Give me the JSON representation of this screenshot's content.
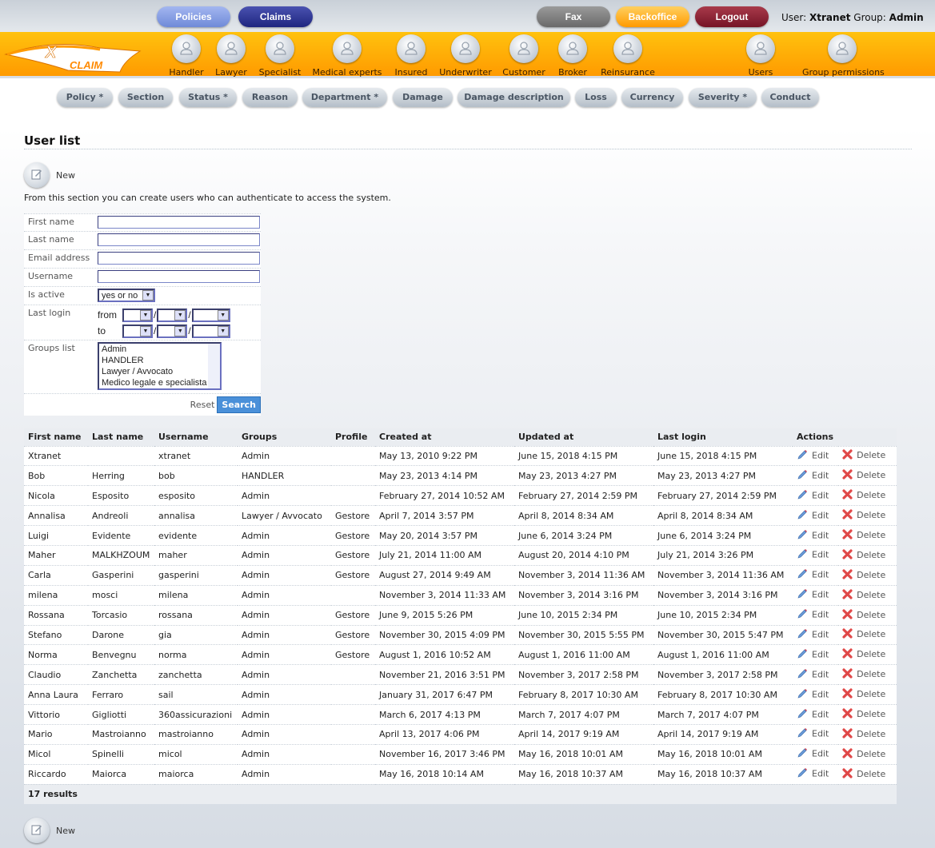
{
  "top_nav": {
    "policies": "Policies",
    "claims": "Claims",
    "fax": "Fax",
    "backoffice": "Backoffice",
    "logout": "Logout"
  },
  "user_info": {
    "user_label": "User:",
    "user": "Xtranet",
    "group_label": "Group:",
    "group": "Admin"
  },
  "logo": {
    "text": "X CLAIM"
  },
  "main_nav": [
    "Handler",
    "Lawyer",
    "Specialist",
    "Medical experts",
    "Insured",
    "Underwriter",
    "Customer",
    "Broker",
    "Reinsurance",
    "Users",
    "Group permissions"
  ],
  "sub_nav": [
    "Policy *",
    "Section",
    "Status *",
    "Reason",
    "Department *",
    "Damage",
    "Damage description",
    "Loss",
    "Currency",
    "Severity *",
    "Conduct"
  ],
  "page": {
    "title": "User list",
    "new_label": "New",
    "intro": "From this section you can create users who can authenticate to access the system."
  },
  "filter": {
    "first_name": "First name",
    "last_name": "Last name",
    "email": "Email address",
    "username": "Username",
    "is_active": "Is active",
    "is_active_value": "yes or no",
    "last_login": "Last login",
    "from": "from",
    "to": "to",
    "sep": "/",
    "groups_list": "Groups list",
    "groups": [
      "Admin",
      "HANDLER",
      "Lawyer / Avvocato",
      "Medico legale e specialista"
    ],
    "reset": "Reset",
    "search": "Search"
  },
  "table": {
    "headers": [
      "First name",
      "Last name",
      "Username",
      "Groups",
      "Profile",
      "Created at",
      "Updated at",
      "Last login",
      "Actions"
    ],
    "edit": "Edit",
    "delete": "Delete",
    "rows": [
      [
        "Xtranet",
        "",
        "xtranet",
        "Admin",
        "",
        "May 13, 2010 9:22 PM",
        "June 15, 2018 4:15 PM",
        "June 15, 2018 4:15 PM"
      ],
      [
        "Bob",
        "Herring",
        "bob",
        "HANDLER",
        "",
        "May 23, 2013 4:14 PM",
        "May 23, 2013 4:27 PM",
        "May 23, 2013 4:27 PM"
      ],
      [
        "Nicola",
        "Esposito",
        "esposito",
        "Admin",
        "",
        "February 27, 2014 10:52 AM",
        "February 27, 2014 2:59 PM",
        "February 27, 2014 2:59 PM"
      ],
      [
        "Annalisa",
        "Andreoli",
        "annalisa",
        "Lawyer / Avvocato",
        "Gestore",
        "April 7, 2014 3:57 PM",
        "April 8, 2014 8:34 AM",
        "April 8, 2014 8:34 AM"
      ],
      [
        "Luigi",
        "Evidente",
        "evidente",
        "Admin",
        "Gestore",
        "May 20, 2014 3:57 PM",
        "June 6, 2014 3:24 PM",
        "June 6, 2014 3:24 PM"
      ],
      [
        "Maher",
        "MALKHZOUM",
        "maher",
        "Admin",
        "Gestore",
        "July 21, 2014 11:00 AM",
        "August 20, 2014 4:10 PM",
        "July 21, 2014 3:26 PM"
      ],
      [
        "Carla",
        "Gasperini",
        "gasperini",
        "Admin",
        "Gestore",
        "August 27, 2014 9:49 AM",
        "November 3, 2014 11:36 AM",
        "November 3, 2014 11:36 AM"
      ],
      [
        "milena",
        "mosci",
        "milena",
        "Admin",
        "",
        "November 3, 2014 11:33 AM",
        "November 3, 2014 3:16 PM",
        "November 3, 2014 3:16 PM"
      ],
      [
        "Rossana",
        "Torcasio",
        "rossana",
        "Admin",
        "Gestore",
        "June 9, 2015 5:26 PM",
        "June 10, 2015 2:34 PM",
        "June 10, 2015 2:34 PM"
      ],
      [
        "Stefano",
        "Darone",
        "gia",
        "Admin",
        "Gestore",
        "November 30, 2015 4:09 PM",
        "November 30, 2015 5:55 PM",
        "November 30, 2015 5:47 PM"
      ],
      [
        "Norma",
        "Benvegnu",
        "norma",
        "Admin",
        "Gestore",
        "August 1, 2016 10:52 AM",
        "August 1, 2016 11:00 AM",
        "August 1, 2016 11:00 AM"
      ],
      [
        "Claudio",
        "Zanchetta",
        "zanchetta",
        "Admin",
        "",
        "November 21, 2016 3:51 PM",
        "November 3, 2017 2:58 PM",
        "November 3, 2017 2:58 PM"
      ],
      [
        "Anna Laura",
        "Ferraro",
        "sail",
        "Admin",
        "",
        "January 31, 2017 6:47 PM",
        "February 8, 2017 10:30 AM",
        "February 8, 2017 10:30 AM"
      ],
      [
        "Vittorio",
        "Gigliotti",
        "360assicurazioni",
        "Admin",
        "",
        "March 6, 2017 4:13 PM",
        "March 7, 2017 4:07 PM",
        "March 7, 2017 4:07 PM"
      ],
      [
        "Mario",
        "Mastroianno",
        "mastroianno",
        "Admin",
        "",
        "April 13, 2017 4:06 PM",
        "April 14, 2017 9:19 AM",
        "April 14, 2017 9:19 AM"
      ],
      [
        "Micol",
        "Spinelli",
        "micol",
        "Admin",
        "",
        "November 16, 2017 3:46 PM",
        "May 16, 2018 10:01 AM",
        "May 16, 2018 10:01 AM"
      ],
      [
        "Riccardo",
        "Maiorca",
        "maiorca",
        "Admin",
        "",
        "May 16, 2018 10:14 AM",
        "May 16, 2018 10:37 AM",
        "May 16, 2018 10:37 AM"
      ]
    ],
    "results": "17 results"
  },
  "colors": {
    "orange": "#ff9a00",
    "policies": "#7f9ae0",
    "claims": "#2a3190",
    "fax": "#7a7a7a",
    "backoffice": "#ffa500",
    "logout": "#8a1d2c",
    "search": "#4a90d9"
  }
}
